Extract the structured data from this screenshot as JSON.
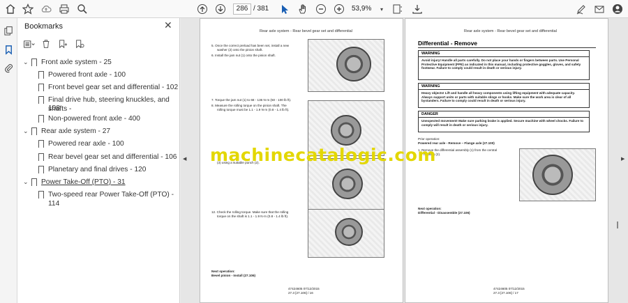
{
  "toolbar": {
    "page_current": "286",
    "page_total": "/ 381",
    "zoom": "53,9%"
  },
  "sidebar": {
    "title": "Bookmarks",
    "items": [
      {
        "label": "Front axle system - 25"
      },
      {
        "label": "Powered front axle - 100"
      },
      {
        "label": "Front bevel gear set and differential - 102"
      },
      {
        "label": "Final drive hub, steering knuckles, and shafts -"
      },
      {
        "label": "108"
      },
      {
        "label": "Non-powered front axle - 400"
      },
      {
        "label": "Rear axle system - 27"
      },
      {
        "label": "Powered rear axle - 100"
      },
      {
        "label": "Rear bevel gear set and differential - 106"
      },
      {
        "label": "Planetary and final drives - 120"
      },
      {
        "label": "Power Take-Off (PTO) - 31"
      },
      {
        "label": "Two-speed rear Power Take-Off (PTO) - 114"
      }
    ]
  },
  "left_page": {
    "header": "Rear axle system - Rear bevel gear set and differential",
    "s5": "5.    Once the correct preload has been set, install a new",
    "s5b": "washer (2) onto the pinion shaft.",
    "s6": "6.    Install the jam nut (1) onto the pinion shaft.",
    "s7": "7.    Torque the jam nut (1) to 68 - 136 N·m (50 - 100 lb ft).",
    "s8": "8.    Measure the rolling torque on the pinion shaft.  The",
    "s8b": "rolling torque must be 1.1 - 1.9 N·m (0.8 - 1.4 lb ft).",
    "s9": "(3) using a suitable punch (2).",
    "s12": "12.   Check the rolling torque.  Make sure that the rolling",
    "s12b": "torque on the shaft is 1.1 - 1.9 N·m (0.8 - 1.4 lb ft).",
    "next_op": "Next operation:",
    "next_link": "Bevel pinion - Install (27.106)",
    "footer1": "47424605 07/12/2015",
    "footer2": "27.3 [27.106] / 16"
  },
  "right_page": {
    "header": "Rear axle system - Rear bevel gear set and differential",
    "title": "Differential - Remove",
    "w1_head": "WARNING",
    "w1_body": "Avoid injury! Handle all parts carefully. Do not place your hands or fingers between parts. Use Personal Protective Equipment (PPE) as indicated in this manual, including protective goggles, gloves, and safety footwear. Failure to comply could result in death or serious injury.",
    "w2_head": "WARNING",
    "w2_body": "Heavy objects! Lift and handle all heavy components using lifting equipment with adequate capacity. Always support units or parts with suitable slings or hooks. Make sure the work area is clear of all bystanders. Failure to comply could result in death or serious injury.",
    "d_head": "DANGER",
    "d_body": "Unexpected movement! Make sure parking brake is applied. Secure machine with wheel chocks. Failure to comply will result in death or serious injury.",
    "prior_op": "Prior operation:",
    "prior_link": "Powered rear axle - Remove – Flange axle (27.100)",
    "s1": "1.    Remove the differential assembly (1) from the central",
    "s1b": "housing (2).",
    "next_op": "Next operation:",
    "next_link": "Differential - Disassemble (27.106)",
    "footer1": "47424605 07/12/2015",
    "footer2": "27.3 [27.106] / 17"
  },
  "watermark": "machinecatalogic.com"
}
